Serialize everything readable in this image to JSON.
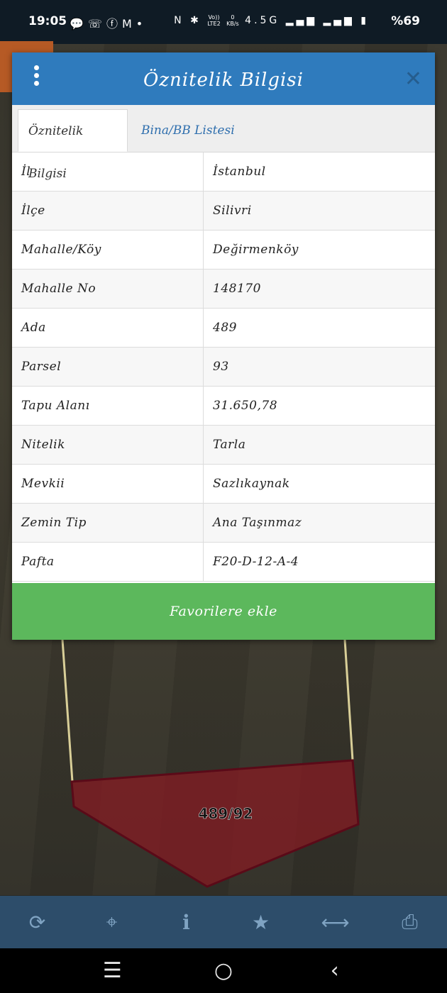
{
  "status_bar": {
    "time": "19:05",
    "left_icons": [
      "chat-icon",
      "missed-call-icon",
      "facebook-icon",
      "gmail-icon",
      "dot-icon"
    ],
    "right_icons": [
      "nfc-icon",
      "bluetooth-icon",
      "volte-icon",
      "data-speed-icon",
      "signal-icon",
      "signal-icon",
      "battery-icon"
    ],
    "net_speed_value": "0",
    "net_speed_unit": "KB/s",
    "volte_top": "Vo))",
    "volte_bottom": "LTE2",
    "network": "4.5G",
    "battery": "%69"
  },
  "dialog": {
    "title": "Öznitelik Bilgisi",
    "tabs": [
      {
        "label": "Öznitelik Bilgisi",
        "active": true
      },
      {
        "label": "Bina/BB Listesi",
        "active": false
      }
    ],
    "rows": [
      {
        "key": "İl",
        "value": "İstanbul"
      },
      {
        "key": "İlçe",
        "value": "Silivri"
      },
      {
        "key": "Mahalle/Köy",
        "value": "Değirmenköy"
      },
      {
        "key": "Mahalle No",
        "value": "148170"
      },
      {
        "key": "Ada",
        "value": "489"
      },
      {
        "key": "Parsel",
        "value": "93"
      },
      {
        "key": "Tapu Alanı",
        "value": "31.650,78"
      },
      {
        "key": "Nitelik",
        "value": "Tarla"
      },
      {
        "key": "Mevkii",
        "value": "Sazlıkaynak"
      },
      {
        "key": "Zemin Tip",
        "value": "Ana Taşınmaz"
      },
      {
        "key": "Pafta",
        "value": "F20-D-12-A-4"
      }
    ],
    "favorite_button": "Favorilere ekle"
  },
  "map": {
    "parcel_label": "489/92"
  },
  "toolbar": {
    "buttons": [
      "refresh-icon",
      "locate-icon",
      "info-icon",
      "star-icon",
      "measure-icon",
      "print-icon"
    ]
  },
  "colors": {
    "header_blue": "#2f7bbd",
    "tab_link": "#2f6fae",
    "favorite_green": "#5cb85c",
    "toolbar_bg": "#2d4d6a",
    "parcel_fill": "#8b1a22"
  }
}
